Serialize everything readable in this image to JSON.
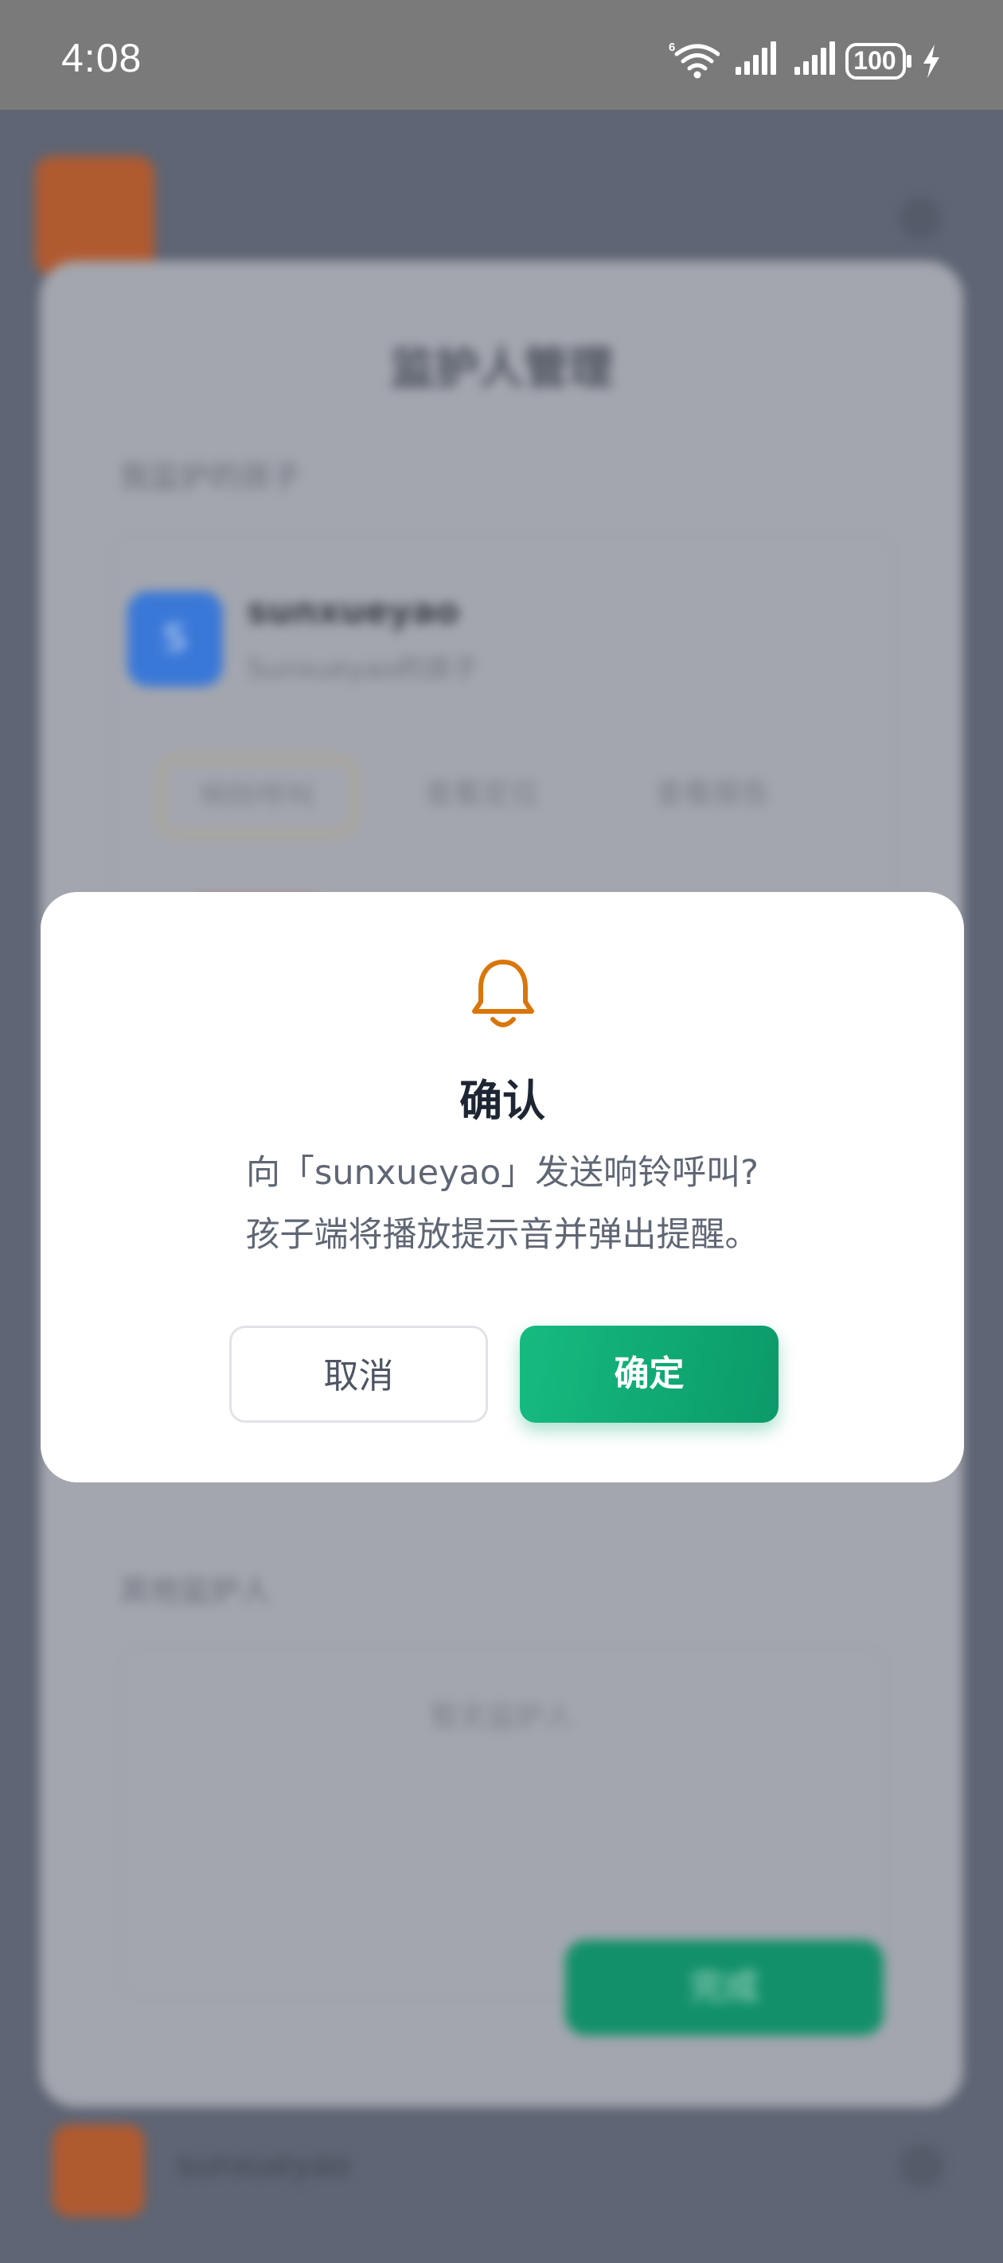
{
  "status_bar": {
    "time": "4:08",
    "battery_level": "100",
    "charging": true,
    "wifi_tag": "6"
  },
  "background": {
    "title": "监护人管理",
    "section_children": "我监护的孩子",
    "member": {
      "avatar_letter": "S",
      "name": "sunxueyao",
      "subtitle": "Sunxueyao的孩子"
    },
    "chips": [
      "响铃呼叫",
      "查看定位",
      "查看报告"
    ],
    "section_guardians": "其他监护人",
    "empty_text": "暂无监护人",
    "save_label": "完成",
    "bottom_name": "sunxueyao"
  },
  "dialog": {
    "icon": "bell-icon",
    "icon_color": "#d9760a",
    "title": "确认",
    "message_line1": "向「sunxueyao」发送响铃呼叫?",
    "message_line2": "孩子端将播放提示音并弹出提醒。",
    "cancel_label": "取消",
    "confirm_label": "确定",
    "confirm_color": "#12a876"
  }
}
